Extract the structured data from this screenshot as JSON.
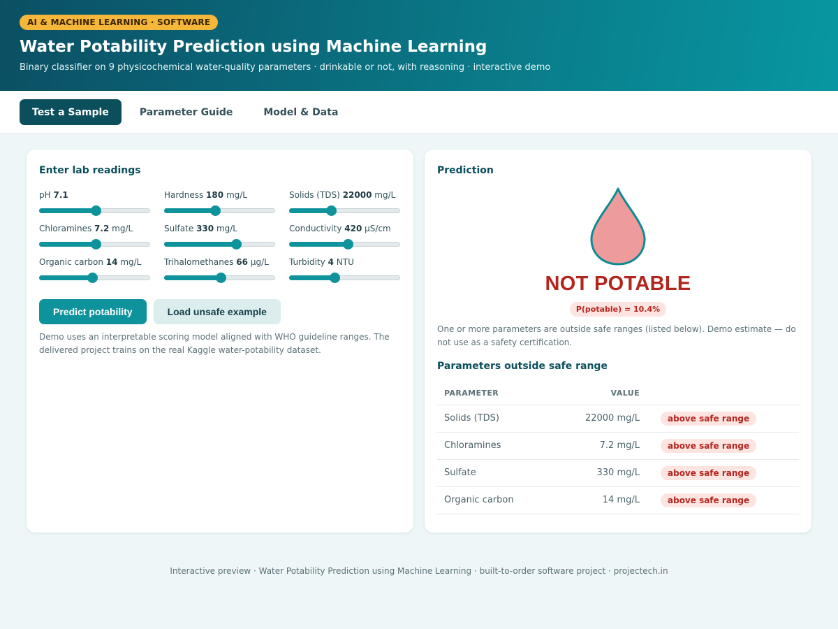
{
  "header": {
    "badge": "AI & MACHINE LEARNING · SOFTWARE",
    "title": "Water Potability Prediction using Machine Learning",
    "subtitle": "Binary classifier on 9 physicochemical water-quality parameters · drinkable or not, with reasoning · interactive demo"
  },
  "tabs": [
    {
      "label": "Test a Sample",
      "active": true
    },
    {
      "label": "Parameter Guide",
      "active": false
    },
    {
      "label": "Model & Data",
      "active": false
    }
  ],
  "input_panel": {
    "title": "Enter lab readings",
    "params": [
      {
        "name": "pH",
        "value": "7.1",
        "unit": "",
        "level": 0.51
      },
      {
        "name": "Hardness",
        "value": "180",
        "unit": "mg/L",
        "level": 0.46
      },
      {
        "name": "Solids (TDS)",
        "value": "22000",
        "unit": "mg/L",
        "level": 0.38
      },
      {
        "name": "Chloramines",
        "value": "7.2",
        "unit": "mg/L",
        "level": 0.51
      },
      {
        "name": "Sulfate",
        "value": "330",
        "unit": "mg/L",
        "level": 0.65
      },
      {
        "name": "Conductivity",
        "value": "420",
        "unit": "µS/cm",
        "level": 0.53
      },
      {
        "name": "Organic carbon",
        "value": "14",
        "unit": "mg/L",
        "level": 0.48
      },
      {
        "name": "Trihalomethanes",
        "value": "66",
        "unit": "µg/L",
        "level": 0.51
      },
      {
        "name": "Turbidity",
        "value": "4",
        "unit": "NTU",
        "level": 0.41
      }
    ],
    "predict_label": "Predict potability",
    "example_label": "Load unsafe example",
    "note": "Demo uses an interpretable scoring model aligned with WHO guideline ranges. The delivered project trains on the real Kaggle water-potability dataset."
  },
  "prediction_panel": {
    "title": "Prediction",
    "verdict": "NOT POTABLE",
    "probability": "P(potable) = 10.4%",
    "note": "One or more parameters are outside safe ranges (listed below). Demo estimate — do not use as a safety certification.",
    "table_title": "Parameters outside safe range",
    "columns": [
      "PARAMETER",
      "VALUE"
    ],
    "rows": [
      {
        "parameter": "Solids (TDS)",
        "value": "22000 mg/L",
        "status": "above safe range"
      },
      {
        "parameter": "Chloramines",
        "value": "7.2 mg/L",
        "status": "above safe range"
      },
      {
        "parameter": "Sulfate",
        "value": "330 mg/L",
        "status": "above safe range"
      },
      {
        "parameter": "Organic carbon",
        "value": "14 mg/L",
        "status": "above safe range"
      }
    ]
  },
  "footer": "Interactive preview · Water Potability Prediction using Machine Learning · built-to-order software project · projectech.in",
  "colors": {
    "accent": "#0e939c",
    "danger": "#b3261e",
    "drop_fill": "#ee9b9b",
    "drop_stroke": "#0e8a94"
  }
}
